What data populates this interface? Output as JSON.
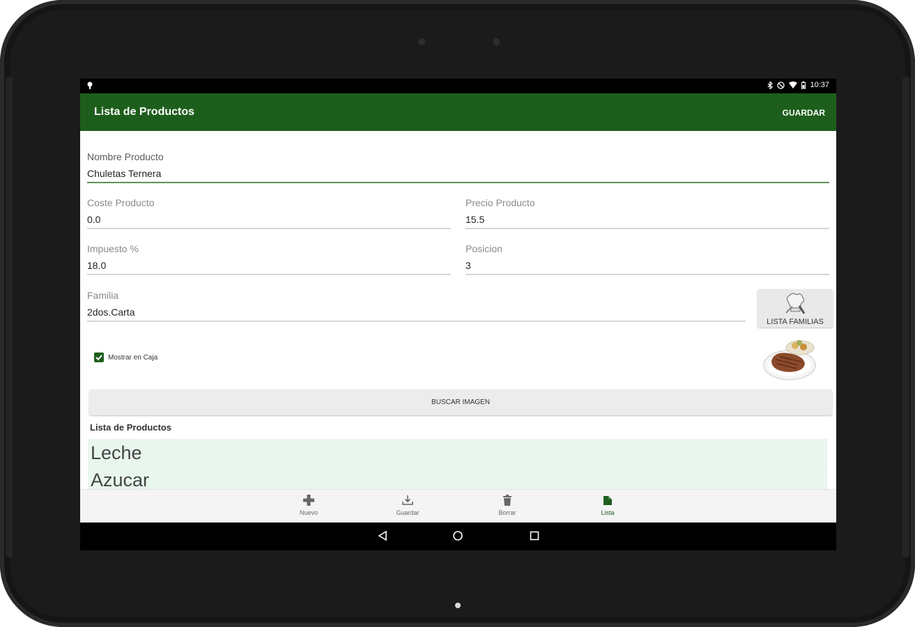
{
  "status_bar": {
    "time": "10:37"
  },
  "app_bar": {
    "title": "Lista de Productos",
    "save_action": "GUARDAR"
  },
  "form": {
    "nombre": {
      "label": "Nombre Producto",
      "value": "Chuletas Ternera"
    },
    "coste": {
      "label": "Coste Producto",
      "value": "0.0"
    },
    "precio": {
      "label": "Precio Producto",
      "value": "15.5"
    },
    "impuesto": {
      "label": "Impuesto %",
      "value": "18.0"
    },
    "posicion": {
      "label": "Posicion",
      "value": "3"
    },
    "familia": {
      "label": "Familia",
      "value": "2dos.Carta"
    },
    "families_button": "LISTA FAMILIAS",
    "show_in_register": {
      "label": "Mostrar en Caja",
      "checked": true
    },
    "search_image_button": "BUSCAR IMAGEN"
  },
  "product_list": {
    "title": "Lista de Productos",
    "items": [
      "Leche",
      "Azucar"
    ]
  },
  "bottom_nav": [
    {
      "label": "Nuevo",
      "icon": "plus-icon"
    },
    {
      "label": "Guardar",
      "icon": "download-icon"
    },
    {
      "label": "Borrar",
      "icon": "trash-icon"
    },
    {
      "label": "Lista",
      "icon": "list-icon",
      "active": true
    }
  ],
  "colors": {
    "primary": "#1e5e1c",
    "list_background": "#e8f6ee"
  }
}
